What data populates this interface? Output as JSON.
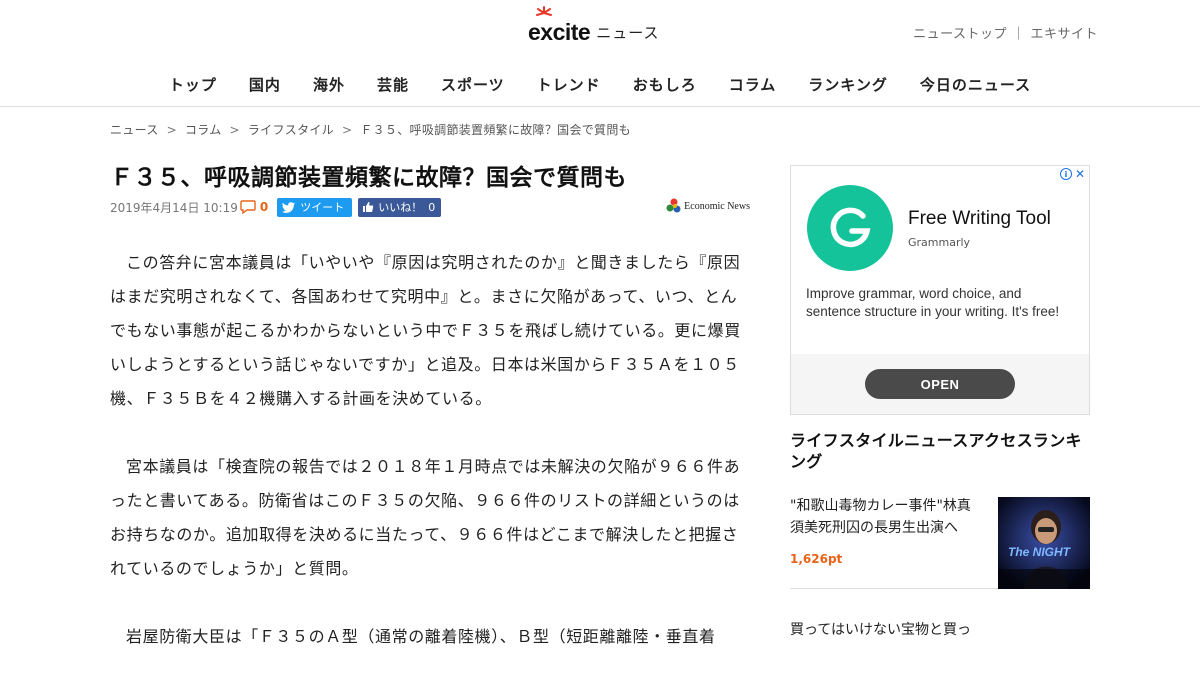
{
  "header": {
    "logo_text": "excite",
    "logo_sub": "ニュース",
    "top_links": [
      "ニューストップ",
      "エキサイト"
    ],
    "top_sep": "｜"
  },
  "nav": [
    "トップ",
    "国内",
    "海外",
    "芸能",
    "スポーツ",
    "トレンド",
    "おもしろ",
    "コラム",
    "ランキング",
    "今日のニュース"
  ],
  "breadcrumb": [
    "ニュース",
    "コラム",
    "ライフスタイル",
    "Ｆ３５、呼吸調節装置頻繁に故障？国会で質問も"
  ],
  "breadcrumb_sep": ">",
  "article": {
    "title": "Ｆ３５、呼吸調節装置頻繁に故障？国会で質問も",
    "date": "2019年4月14日 10:19",
    "comment_count": "0",
    "tweet_label": "ツイート",
    "like_label": "いいね！",
    "like_count": "0",
    "source": "Economic News",
    "paragraphs": [
      "この答弁に宮本議員は「いやいや『原因は究明されたのか』と聞きましたら『原因はまだ究明されなくて、各国あわせて究明中』と。まさに欠陥があって、いつ、とんでもない事態が起こるかわからないという中でＦ３５を飛ばし続けている。更に爆買いしようとするという話じゃないですか」と追及。日本は米国からＦ３５Ａを１０５機、Ｆ３５Ｂを４２機購入する計画を決めている。",
      "宮本議員は「検査院の報告では２０１８年１月時点では未解決の欠陥が９６６件あったと書いてある。防衛省はこのＦ３５の欠陥、９６６件のリストの詳細というのはお持ちなのか。追加取得を決めるに当たって、９６６件はどこまで解決したと把握されているのでしょうか」と質問。",
      "岩屋防衛大臣は「Ｆ３５のＡ型（通常の離着陸機）、Ｂ型（短距離離陸・垂直着"
    ]
  },
  "ad": {
    "title": "Free Writing Tool",
    "brand": "Grammarly",
    "description": "Improve grammar, word choice, and sentence structure in your writing. It's free!",
    "cta": "OPEN",
    "brand_color": "#15c39a"
  },
  "ranking": {
    "heading": "ライフスタイルニュースアクセスランキング",
    "items": [
      {
        "text": "\"和歌山毒物カレー事件\"林真須美死刑囚の長男生出演へ",
        "points": "1,626pt",
        "thumb_label": "The NIGHT"
      },
      {
        "text": "買ってはいけない宝物と買っ"
      }
    ]
  },
  "colors": {
    "accent": "#e8631a",
    "twitter": "#1d9bf0",
    "facebook": "#3b5998"
  }
}
